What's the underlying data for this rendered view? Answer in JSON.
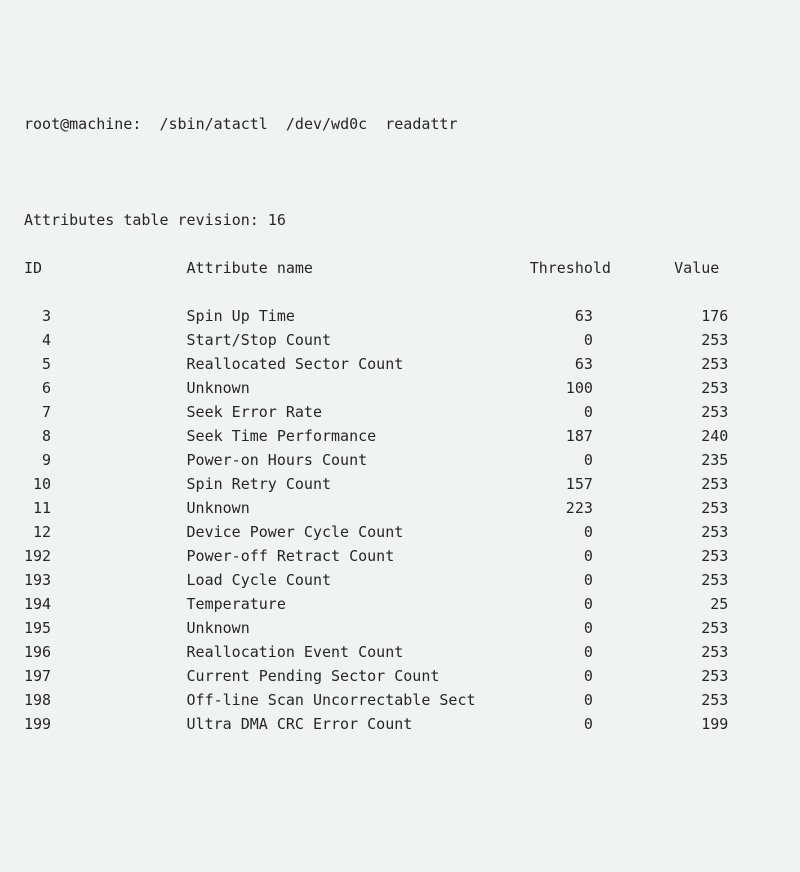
{
  "command": {
    "prompt": "root@machine:",
    "program": "/sbin/atactl",
    "device": "/dev/wd0c",
    "subcommand": "readattr"
  },
  "revision_line": "Attributes table revision: 16",
  "header": {
    "id": "ID",
    "name": "Attribute name",
    "threshold": "Threshold",
    "value": "Value"
  },
  "attributes": [
    {
      "id": "3",
      "name": "Spin Up Time",
      "threshold": "63",
      "value": "176"
    },
    {
      "id": "4",
      "name": "Start/Stop Count",
      "threshold": "0",
      "value": "253"
    },
    {
      "id": "5",
      "name": "Reallocated Sector Count",
      "threshold": "63",
      "value": "253"
    },
    {
      "id": "6",
      "name": "Unknown",
      "threshold": "100",
      "value": "253"
    },
    {
      "id": "7",
      "name": "Seek Error Rate",
      "threshold": "0",
      "value": "253"
    },
    {
      "id": "8",
      "name": "Seek Time Performance",
      "threshold": "187",
      "value": "240"
    },
    {
      "id": "9",
      "name": "Power-on Hours Count",
      "threshold": "0",
      "value": "235"
    },
    {
      "id": "10",
      "name": "Spin Retry Count",
      "threshold": "157",
      "value": "253"
    },
    {
      "id": "11",
      "name": "Unknown",
      "threshold": "223",
      "value": "253"
    },
    {
      "id": "12",
      "name": "Device Power Cycle Count",
      "threshold": "0",
      "value": "253"
    },
    {
      "id": "192",
      "name": "Power-off Retract Count",
      "threshold": "0",
      "value": "253"
    },
    {
      "id": "193",
      "name": "Load Cycle Count",
      "threshold": "0",
      "value": "253"
    },
    {
      "id": "194",
      "name": "Temperature",
      "threshold": "0",
      "value": "25"
    },
    {
      "id": "195",
      "name": "Unknown",
      "threshold": "0",
      "value": "253"
    },
    {
      "id": "196",
      "name": "Reallocation Event Count",
      "threshold": "0",
      "value": "253"
    },
    {
      "id": "197",
      "name": "Current Pending Sector Count",
      "threshold": "0",
      "value": "253"
    },
    {
      "id": "198",
      "name": "Off-line Scan Uncorrectable Sect",
      "threshold": "0",
      "value": "253"
    },
    {
      "id": "199",
      "name": "Ultra DMA CRC Error Count",
      "threshold": "0",
      "value": "199"
    }
  ]
}
